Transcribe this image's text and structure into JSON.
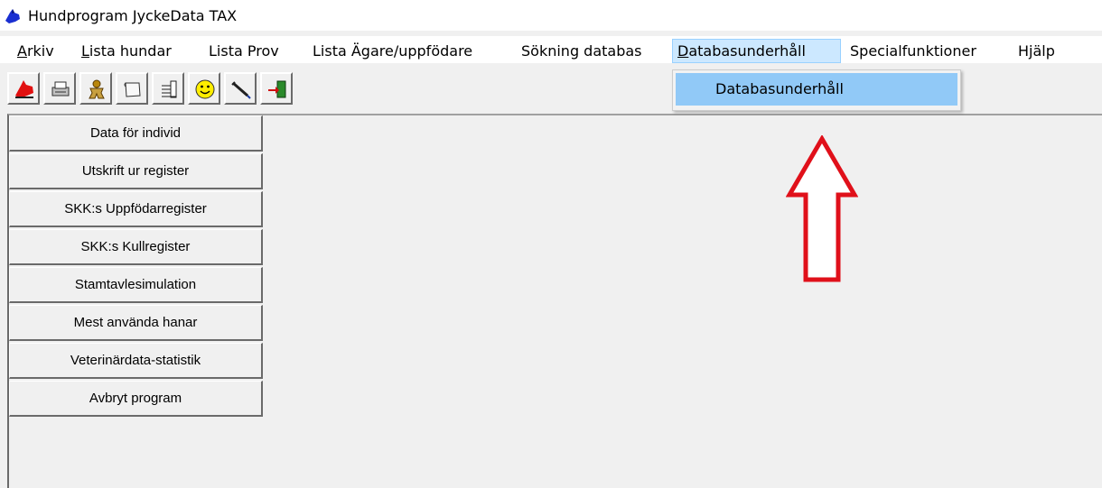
{
  "window": {
    "title": "Hundprogram JyckeData TAX",
    "app_icon": "dog-icon"
  },
  "menu": {
    "items": [
      {
        "label": "Arkiv",
        "mnemonic": "A",
        "rest": "rkiv"
      },
      {
        "label": "Lista hundar",
        "mnemonic": "L",
        "rest": "ista hundar"
      },
      {
        "label": "Lista Prov"
      },
      {
        "label": "Lista Ägare/uppfödare"
      },
      {
        "label": "Sökning databas"
      },
      {
        "label": "Databasunderhåll",
        "mnemonic": "D",
        "rest": "atabasunderhåll",
        "active": true
      },
      {
        "label": "Specialfunktioner"
      },
      {
        "label": "Hjälp"
      }
    ]
  },
  "dropdown": {
    "items": [
      {
        "label": "Databasunderhåll"
      }
    ]
  },
  "toolbar": {
    "buttons": [
      "dog-icon",
      "printer-icon",
      "person-icon",
      "document-icon",
      "list-icon",
      "smiley-icon",
      "syringe-icon",
      "exit-door-icon"
    ]
  },
  "sidebar": {
    "buttons": [
      "Data för individ",
      "Utskrift ur register",
      "SKK:s Uppfödarregister",
      "SKK:s Kullregister",
      "Stamtavlesimulation",
      "Mest använda hanar",
      "Veterinärdata-statistik",
      "Avbryt program"
    ]
  },
  "colors": {
    "menu_active_bg": "#cce8ff",
    "dropdown_highlight": "#91c9f7",
    "arrow": "#e0101a"
  }
}
